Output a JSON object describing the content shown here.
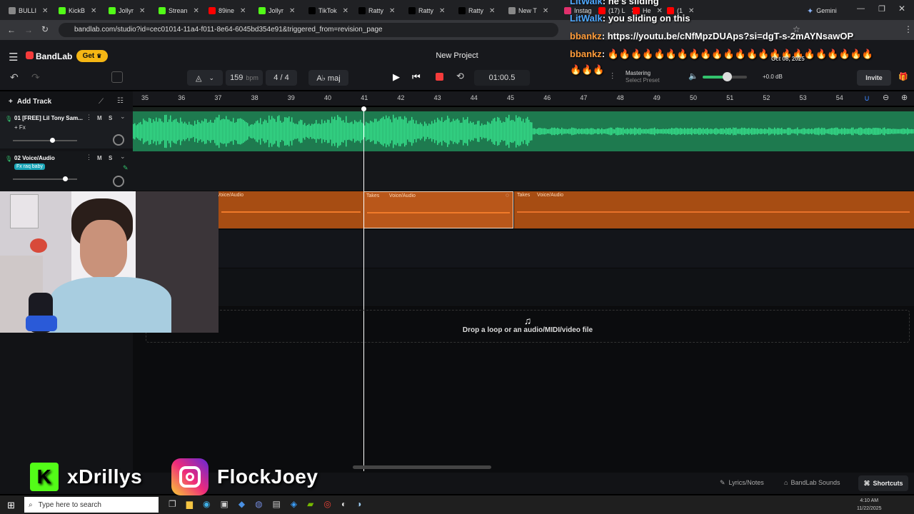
{
  "browser": {
    "tabs": [
      {
        "label": "BULLI",
        "color": "#888"
      },
      {
        "label": "KickB",
        "color": "#53fc18"
      },
      {
        "label": "Jollyr",
        "color": "#53fc18"
      },
      {
        "label": "Strean",
        "color": "#53fc18"
      },
      {
        "label": "89ine",
        "color": "#ff0000"
      },
      {
        "label": "Jollyr",
        "color": "#53fc18"
      },
      {
        "label": "TikTok",
        "color": "#000000"
      },
      {
        "label": "Ratty",
        "color": "#000000"
      },
      {
        "label": "Ratty",
        "color": "#000000"
      },
      {
        "label": "Ratty",
        "color": "#000000"
      },
      {
        "label": "New T",
        "color": "#888"
      },
      {
        "label": "Instag",
        "color": "#e1306c"
      },
      {
        "label": "(17) L",
        "color": "#ff0000"
      },
      {
        "label": "He",
        "color": "#ff0000"
      },
      {
        "label": "(1",
        "color": "#ff0000"
      }
    ],
    "gemini_label": "Gemini",
    "url": "bandlab.com/studio?id=cec01014-11a4-f011-8e64-6045bd354e91&triggered_from=revision_page"
  },
  "chat": {
    "messages": [
      {
        "user": "LitWalk",
        "text": ": he's sliding",
        "color": "#4fa8ff"
      },
      {
        "user": "LitWalk",
        "text": ": you sliding on this",
        "color": "#4fa8ff"
      },
      {
        "user": "bbankz",
        "text": ": https://youtu.be/cNfMpzDUAps?si=dgT-s-2mAYNsawOP",
        "color": "#ff9c3a"
      },
      {
        "user": "bbankz",
        "text": ": 🔥🔥🔥🔥🔥🔥🔥🔥🔥🔥🔥🔥🔥🔥🔥🔥🔥🔥🔥🔥🔥🔥🔥",
        "color": "#ff9c3a"
      }
    ],
    "overflow_emojis": "🔥🔥🔥",
    "date_overlay": "Oct 08, 2025"
  },
  "header": {
    "app_name": "BandLab",
    "get_label": "Get",
    "project_title": "New Project"
  },
  "toolbar": {
    "bpm": "159",
    "bpm_unit": "bpm",
    "time_sig": "4 / 4",
    "key": "A♭ maj",
    "time": "01:00.5",
    "mastering_label": "Mastering",
    "mastering_sub": "Select Preset",
    "volume_db": "+0.0 dB",
    "invite_label": "Invite",
    "volume_level": 0.55
  },
  "tracks": {
    "add_track_label": "Add Track",
    "items": [
      {
        "name": "01  [FREE] Lil Tony Sam...",
        "fx": "+ Fx",
        "mute": "M",
        "solo": "S"
      },
      {
        "name": "02  Voice/Audio",
        "fx": "Fx raq baby",
        "mute": "M",
        "solo": "S"
      }
    ]
  },
  "ruler": {
    "ticks": [
      "35",
      "36",
      "37",
      "38",
      "39",
      "40",
      "41",
      "42",
      "43",
      "44",
      "45",
      "46",
      "47",
      "48",
      "49",
      "50",
      "51",
      "52",
      "53",
      "54"
    ]
  },
  "regions": {
    "orange": [
      {
        "takes": "Takes",
        "name": "Voice/Audio"
      },
      {
        "takes": "Takes",
        "name": "Voice/Audio"
      },
      {
        "takes": "Takes",
        "name": "Voice/Audio"
      }
    ]
  },
  "dropzone": {
    "text": "Drop a loop or an audio/MIDI/video file"
  },
  "bottom": {
    "lyrics_label": "Lyrics/Notes",
    "sounds_label": "BandLab Sounds",
    "shortcuts_label": "Shortcuts"
  },
  "social": {
    "kick_handle": "xDrillys",
    "instagram_handle": "FlockJoey"
  },
  "taskbar": {
    "search_placeholder": "Type here to search",
    "clock_time": "4:10 AM",
    "clock_date": "11/22/2025"
  }
}
